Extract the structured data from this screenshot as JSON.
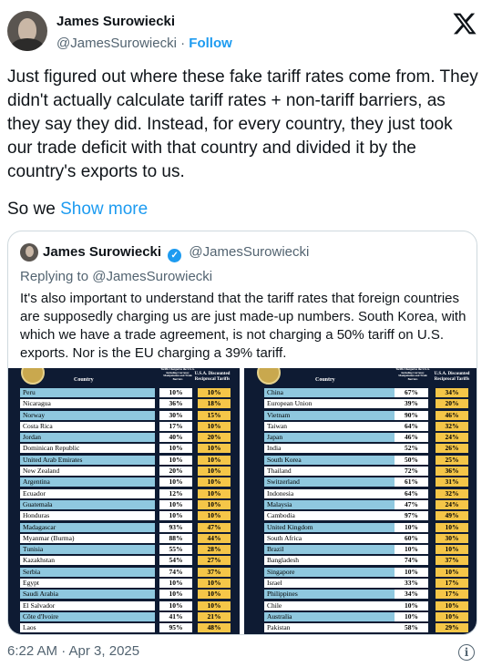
{
  "author": {
    "name": "James Surowiecki",
    "handle": "@JamesSurowiecki",
    "separator": "·",
    "follow_label": "Follow"
  },
  "tweet": {
    "text": "Just figured out where these fake tariff rates come from. They didn't actually calculate tariff rates + non-tariff barriers, as they say they did. Instead, for every country, they just took our trade deficit with that country and divided it by the country's exports to us.",
    "truncated_text": "So we",
    "show_more_label": "Show more",
    "timestamp": "6:22 AM · Apr 3, 2025"
  },
  "quote": {
    "name": "James Surowiecki",
    "handle": "@JamesSurowiecki",
    "reply_label": "Replying to @JamesSurowiecki",
    "text": "It's also important to understand that the tariff rates that foreign countries are supposedly charging us are just made-up numbers. South Korea, with which we have a trade agreement, is not charging a 50% tariff on U.S. exports. Nor is the EU charging a 39% tariff.",
    "table": {
      "header_country": "Country",
      "header_charged": "Tariffs Charged to the U.S.A. Including Currency Manipulation and Trade Barriers",
      "header_discounted": "U.S.A. Discounted Reciprocal Tariffs",
      "left_rows": [
        {
          "country": "Peru",
          "charged": "10%",
          "discounted": "10%"
        },
        {
          "country": "Nicaragua",
          "charged": "36%",
          "discounted": "18%"
        },
        {
          "country": "Norway",
          "charged": "30%",
          "discounted": "15%"
        },
        {
          "country": "Costa Rica",
          "charged": "17%",
          "discounted": "10%"
        },
        {
          "country": "Jordan",
          "charged": "40%",
          "discounted": "20%"
        },
        {
          "country": "Dominican Republic",
          "charged": "10%",
          "discounted": "10%"
        },
        {
          "country": "United Arab Emirates",
          "charged": "10%",
          "discounted": "10%"
        },
        {
          "country": "New Zealand",
          "charged": "20%",
          "discounted": "10%"
        },
        {
          "country": "Argentina",
          "charged": "10%",
          "discounted": "10%"
        },
        {
          "country": "Ecuador",
          "charged": "12%",
          "discounted": "10%"
        },
        {
          "country": "Guatemala",
          "charged": "10%",
          "discounted": "10%"
        },
        {
          "country": "Honduras",
          "charged": "10%",
          "discounted": "10%"
        },
        {
          "country": "Madagascar",
          "charged": "93%",
          "discounted": "47%"
        },
        {
          "country": "Myanmar (Burma)",
          "charged": "88%",
          "discounted": "44%"
        },
        {
          "country": "Tunisia",
          "charged": "55%",
          "discounted": "28%"
        },
        {
          "country": "Kazakhstan",
          "charged": "54%",
          "discounted": "27%"
        },
        {
          "country": "Serbia",
          "charged": "74%",
          "discounted": "37%"
        },
        {
          "country": "Egypt",
          "charged": "10%",
          "discounted": "10%"
        },
        {
          "country": "Saudi Arabia",
          "charged": "10%",
          "discounted": "10%"
        },
        {
          "country": "El Salvador",
          "charged": "10%",
          "discounted": "10%"
        },
        {
          "country": "Côte d'Ivoire",
          "charged": "41%",
          "discounted": "21%"
        },
        {
          "country": "Laos",
          "charged": "95%",
          "discounted": "48%"
        }
      ],
      "right_rows": [
        {
          "country": "China",
          "charged": "67%",
          "discounted": "34%"
        },
        {
          "country": "European Union",
          "charged": "39%",
          "discounted": "20%"
        },
        {
          "country": "Vietnam",
          "charged": "90%",
          "discounted": "46%"
        },
        {
          "country": "Taiwan",
          "charged": "64%",
          "discounted": "32%"
        },
        {
          "country": "Japan",
          "charged": "46%",
          "discounted": "24%"
        },
        {
          "country": "India",
          "charged": "52%",
          "discounted": "26%"
        },
        {
          "country": "South Korea",
          "charged": "50%",
          "discounted": "25%"
        },
        {
          "country": "Thailand",
          "charged": "72%",
          "discounted": "36%"
        },
        {
          "country": "Switzerland",
          "charged": "61%",
          "discounted": "31%"
        },
        {
          "country": "Indonesia",
          "charged": "64%",
          "discounted": "32%"
        },
        {
          "country": "Malaysia",
          "charged": "47%",
          "discounted": "24%"
        },
        {
          "country": "Cambodia",
          "charged": "97%",
          "discounted": "49%"
        },
        {
          "country": "United Kingdom",
          "charged": "10%",
          "discounted": "10%"
        },
        {
          "country": "South Africa",
          "charged": "60%",
          "discounted": "30%"
        },
        {
          "country": "Brazil",
          "charged": "10%",
          "discounted": "10%"
        },
        {
          "country": "Bangladesh",
          "charged": "74%",
          "discounted": "37%"
        },
        {
          "country": "Singapore",
          "charged": "10%",
          "discounted": "10%"
        },
        {
          "country": "Israel",
          "charged": "33%",
          "discounted": "17%"
        },
        {
          "country": "Philippines",
          "charged": "34%",
          "discounted": "17%"
        },
        {
          "country": "Chile",
          "charged": "10%",
          "discounted": "10%"
        },
        {
          "country": "Australia",
          "charged": "10%",
          "discounted": "10%"
        },
        {
          "country": "Pakistan",
          "charged": "58%",
          "discounted": "29%"
        }
      ]
    }
  },
  "colors": {
    "link": "#1d9bf0",
    "muted": "#536471",
    "table_bg": "#0e1b33",
    "row_blue": "#8fc8df",
    "discount_yellow": "#f5c648"
  },
  "icons": [
    "x-logo-icon",
    "verified-badge-icon",
    "info-icon"
  ]
}
